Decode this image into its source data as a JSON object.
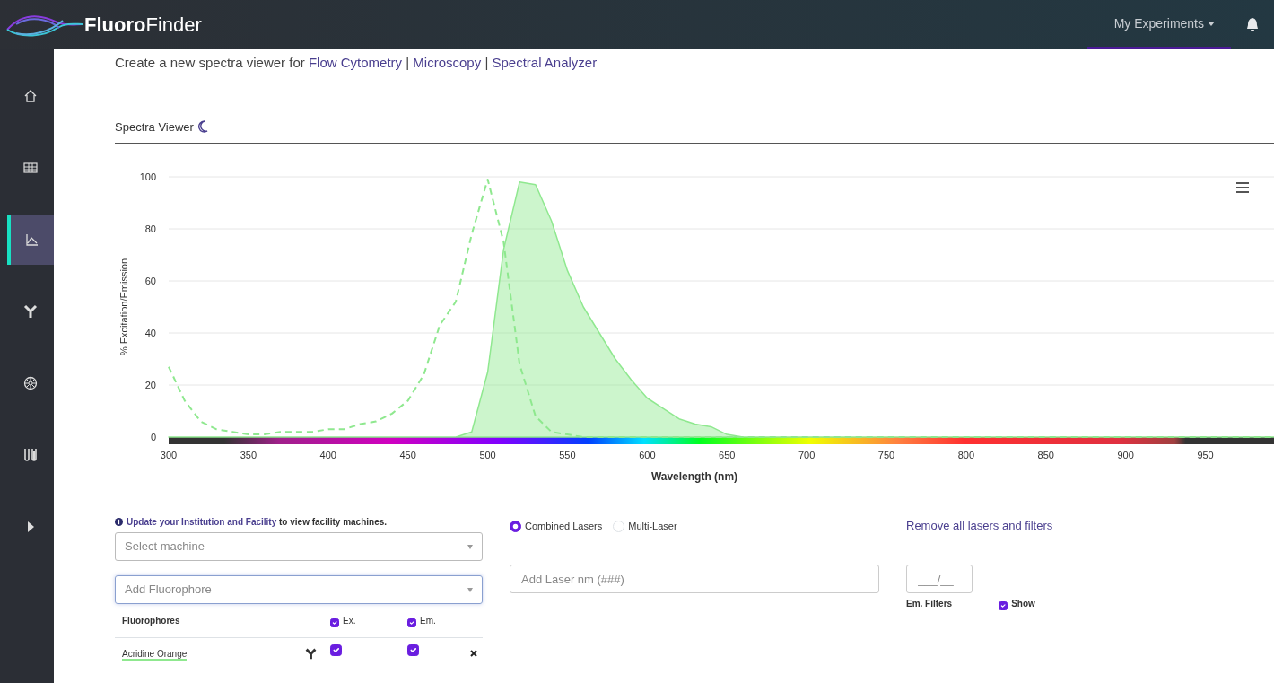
{
  "header": {
    "brand_bold": "Fluoro",
    "brand_light": "Finder",
    "menu": "My Experiments"
  },
  "sidebar": {
    "items": [
      {
        "kind": "home",
        "selected": false
      },
      {
        "kind": "table",
        "selected": false
      },
      {
        "kind": "chart",
        "selected": true
      },
      {
        "kind": "antibody",
        "selected": false
      },
      {
        "kind": "wheel",
        "selected": false
      },
      {
        "kind": "tubes",
        "selected": false
      },
      {
        "kind": "expand",
        "selected": false
      }
    ]
  },
  "intro": {
    "text": "Create a new spectra viewer for",
    "separator": "|",
    "links": [
      "Flow Cytometry",
      "Microscopy",
      "Spectral Analyzer"
    ]
  },
  "viewer": {
    "title": "Spectra Viewer"
  },
  "chart": {
    "chart_data": {
      "type": "line",
      "xlabel": "Wavelength (nm)",
      "ylabel": "% Excitation/Emission",
      "x": [
        300,
        310,
        320,
        330,
        340,
        350,
        360,
        370,
        380,
        390,
        400,
        410,
        420,
        430,
        440,
        450,
        460,
        470,
        480,
        490,
        500,
        510,
        520,
        530,
        540,
        550,
        560,
        570,
        580,
        590,
        600,
        610,
        620,
        630,
        640,
        650,
        660,
        670,
        680,
        690,
        700,
        750,
        800,
        850,
        900,
        950,
        993
      ],
      "series": [
        {
          "type": "line",
          "line_style": "dashed",
          "color": "#8fe88f",
          "values": [
            27,
            14,
            6,
            3,
            2,
            1,
            1,
            2,
            2,
            2,
            3,
            3,
            5,
            6,
            9,
            14,
            24,
            43,
            52,
            78,
            99,
            75,
            28,
            8,
            2,
            1,
            0,
            0,
            0,
            0,
            0,
            0,
            0,
            0,
            0,
            0,
            0,
            0,
            0,
            0,
            0,
            0,
            0,
            0,
            0,
            0,
            0
          ]
        },
        {
          "type": "area",
          "color": "#8fe88f",
          "values": [
            0,
            0,
            0,
            0,
            0,
            0,
            0,
            0,
            0,
            0,
            0,
            0,
            0,
            0,
            0,
            0,
            0,
            0,
            0,
            2,
            25,
            72,
            98,
            97,
            83,
            64,
            50,
            40,
            30,
            22,
            15,
            11,
            7,
            5,
            4,
            1,
            0,
            0,
            0,
            0,
            0,
            0,
            0,
            0,
            0,
            0,
            0
          ]
        }
      ],
      "xlim": [
        300,
        993
      ],
      "ylim": [
        0,
        100
      ],
      "xticks": [
        300,
        350,
        400,
        450,
        500,
        550,
        600,
        650,
        700,
        750,
        800,
        850,
        900,
        950
      ],
      "yticks": [
        0,
        20,
        40,
        60,
        80,
        100
      ],
      "grid": true
    }
  },
  "machine": {
    "notice_link": "Update your Institution and Facility",
    "notice_text": "to view facility machines.",
    "placeholder": "Select machine"
  },
  "fluorophore_select": {
    "placeholder": "Add Fluorophore"
  },
  "fluorophore_table": {
    "header": "Fluorophores",
    "ex_label": "Ex.",
    "em_label": "Em.",
    "ex_all": true,
    "em_all": true,
    "rows": [
      {
        "name": "Acridine Orange",
        "color": "#8fe88f",
        "ex": true,
        "em": true
      }
    ]
  },
  "laser_modes": [
    {
      "label": "Combined Lasers",
      "selected": true
    },
    {
      "label": "Multi-Laser",
      "selected": false
    }
  ],
  "remove_link": "Remove all lasers and filters",
  "laser_input": {
    "placeholder": "Add Laser nm (###)"
  },
  "filter_input": {
    "placeholder": "___/__"
  },
  "filters": {
    "label": "Em. Filters",
    "show_label": "Show",
    "show": true
  }
}
